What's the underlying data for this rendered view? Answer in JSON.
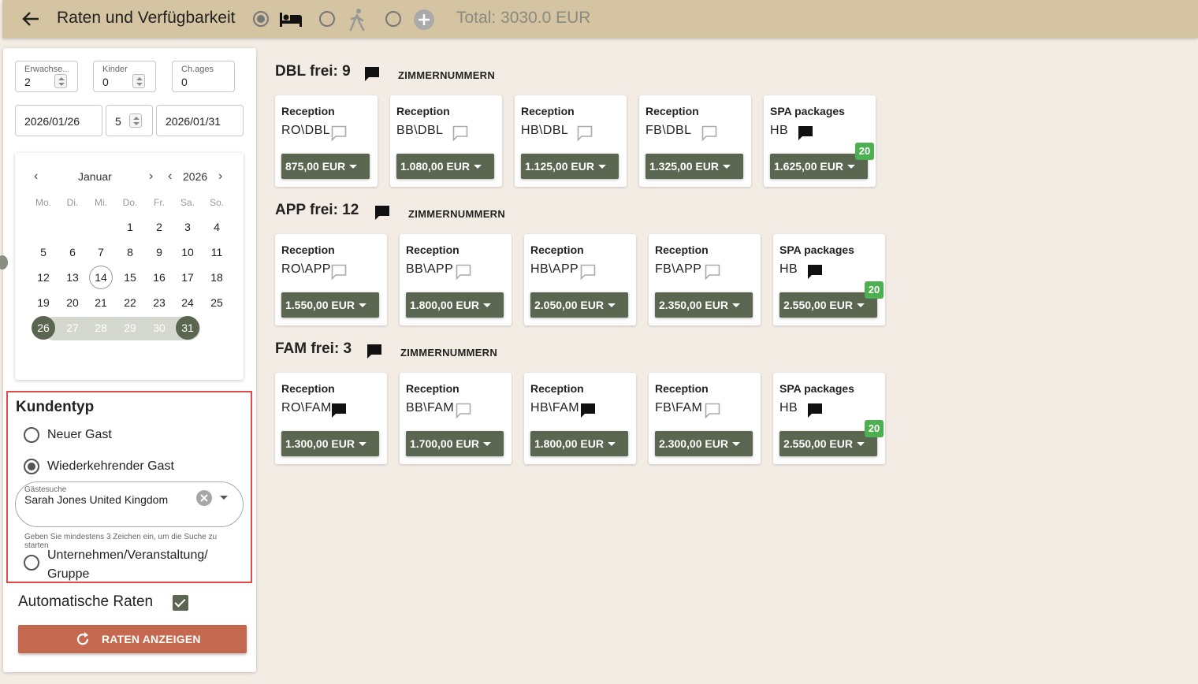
{
  "header": {
    "title": "Raten und Verfügbarkeit",
    "total": "Total: 3030.0 EUR",
    "modes": [
      {
        "icon": "bed-icon",
        "selected": true
      },
      {
        "icon": "walking-person-icon",
        "selected": false
      },
      {
        "icon": "plus-circle-icon",
        "selected": false
      }
    ]
  },
  "filters": {
    "adults_label": "Erwachse...",
    "adults_value": "2",
    "children_label": "Kinder",
    "children_value": "0",
    "chages_label": "Ch.ages",
    "chages_value": "0",
    "arrival": "2026/01/26",
    "nights": "5",
    "departure": "2026/01/31"
  },
  "calendar": {
    "month": "Januar",
    "year": "2026",
    "weekdays": [
      "Mo.",
      "Di.",
      "Mi.",
      "Do.",
      "Fr.",
      "Sa.",
      "So."
    ],
    "weeks": [
      [
        "",
        "",
        "",
        "1",
        "2",
        "3",
        "4"
      ],
      [
        "5",
        "6",
        "7",
        "8",
        "9",
        "10",
        "11"
      ],
      [
        "12",
        "13",
        "14",
        "15",
        "16",
        "17",
        "18"
      ],
      [
        "19",
        "20",
        "21",
        "22",
        "23",
        "24",
        "25"
      ],
      [
        "26",
        "27",
        "28",
        "29",
        "30",
        "31",
        ""
      ]
    ],
    "today": "14",
    "range_start": "26",
    "range_end": "31"
  },
  "kundentyp": {
    "title": "Kundentyp",
    "options": [
      {
        "label": "Neuer Gast",
        "selected": false
      },
      {
        "label": "Wiederkehrender Gast",
        "selected": true
      },
      {
        "label": "Unternehmen/Veranstaltung/\nGruppe",
        "selected": false
      }
    ],
    "guest_search_label": "Gästesuche",
    "guest_search_value": "Sarah Jones United Kingdom",
    "hint": "Geben Sie mindestens 3 Zeichen ein, um die Suche zu starten"
  },
  "auto_rates_label": "Automatische Raten",
  "auto_rates_checked": true,
  "show_rates_button": "RATEN ANZEIGEN",
  "room_link_label": "ZIMMERNUMMERN",
  "sections": [
    {
      "title": "DBL frei: 9",
      "cards": [
        {
          "category": "Reception",
          "code": "RO\\DBL",
          "note_filled": false,
          "price": "875,00 EUR"
        },
        {
          "category": "Reception",
          "code": "BB\\DBL",
          "note_filled": false,
          "price": "1.080,00 EUR"
        },
        {
          "category": "Reception",
          "code": "HB\\DBL",
          "note_filled": false,
          "price": "1.125,00 EUR"
        },
        {
          "category": "Reception",
          "code": "FB\\DBL",
          "note_filled": false,
          "price": "1.325,00 EUR"
        },
        {
          "category": "SPA packages",
          "code": "HB",
          "note_filled": true,
          "price": "1.625,00 EUR",
          "badge": "20"
        }
      ]
    },
    {
      "title": "APP frei: 12",
      "cards": [
        {
          "category": "Reception",
          "code": "RO\\APP",
          "note_filled": false,
          "price": "1.550,00 EUR"
        },
        {
          "category": "Reception",
          "code": "BB\\APP",
          "note_filled": false,
          "price": "1.800,00 EUR"
        },
        {
          "category": "Reception",
          "code": "HB\\APP",
          "note_filled": false,
          "price": "2.050,00 EUR"
        },
        {
          "category": "Reception",
          "code": "FB\\APP",
          "note_filled": false,
          "price": "2.350,00 EUR"
        },
        {
          "category": "SPA packages",
          "code": "HB",
          "note_filled": true,
          "price": "2.550,00 EUR",
          "badge": "20"
        }
      ]
    },
    {
      "title": "FAM frei: 3",
      "cards": [
        {
          "category": "Reception",
          "code": "RO\\FAM",
          "note_filled": true,
          "price": "1.300,00 EUR"
        },
        {
          "category": "Reception",
          "code": "BB\\FAM",
          "note_filled": false,
          "price": "1.700,00 EUR"
        },
        {
          "category": "Reception",
          "code": "HB\\FAM",
          "note_filled": true,
          "price": "1.800,00 EUR"
        },
        {
          "category": "Reception",
          "code": "FB\\FAM",
          "note_filled": false,
          "price": "2.300,00 EUR"
        },
        {
          "category": "SPA packages",
          "code": "HB",
          "note_filled": true,
          "price": "2.550,00 EUR",
          "badge": "20"
        }
      ]
    }
  ],
  "colors": {
    "header_bg": "#d4c4a1",
    "page_bg": "#f3ece5",
    "price_button": "#5b6650",
    "primary_button": "#c4694f",
    "badge": "#4caf50",
    "highlight_border": "#e24a4a"
  }
}
